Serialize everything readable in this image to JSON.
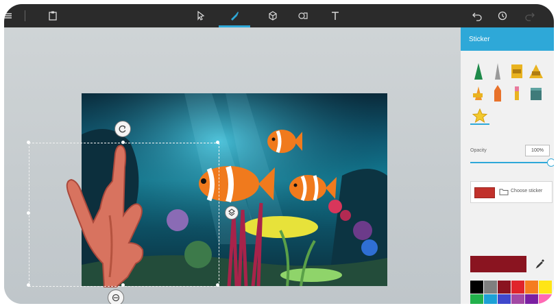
{
  "panel": {
    "title": "Sticker",
    "opacity_label": "Opacity",
    "opacity_value": "100%",
    "opacity_fraction": 1.0,
    "choose_label": "Choose sticker",
    "current_color": "#8a1420"
  },
  "toolbar": {
    "icons": [
      "menu-icon",
      "paste-icon",
      "select-icon",
      "brush-icon",
      "3d-objects-icon",
      "stickers-icon",
      "text-icon",
      "undo-icon",
      "history-icon",
      "redo-icon"
    ],
    "active_tab": "brush-icon",
    "accent": "#2ea8d8"
  },
  "palette": {
    "colors": [
      "#000000",
      "#7f7f7f",
      "#8a1420",
      "#e0242b",
      "#f57d1f",
      "#ffe516",
      "#22b14c",
      "#1da1d6",
      "#3f48cc",
      "#a349a4",
      "#7b1fa2",
      "#ff69b4"
    ]
  },
  "stickers": [
    "green-cone-sticker",
    "gray-cone-sticker",
    "gold-cylinder-2d-sticker",
    "gold-pyramid-2d-sticker",
    "orange-cone-2d-sticker",
    "orange-bottle-sticker",
    "pink-vial-sticker",
    "teal-block-sticker",
    "star-sticker"
  ]
}
